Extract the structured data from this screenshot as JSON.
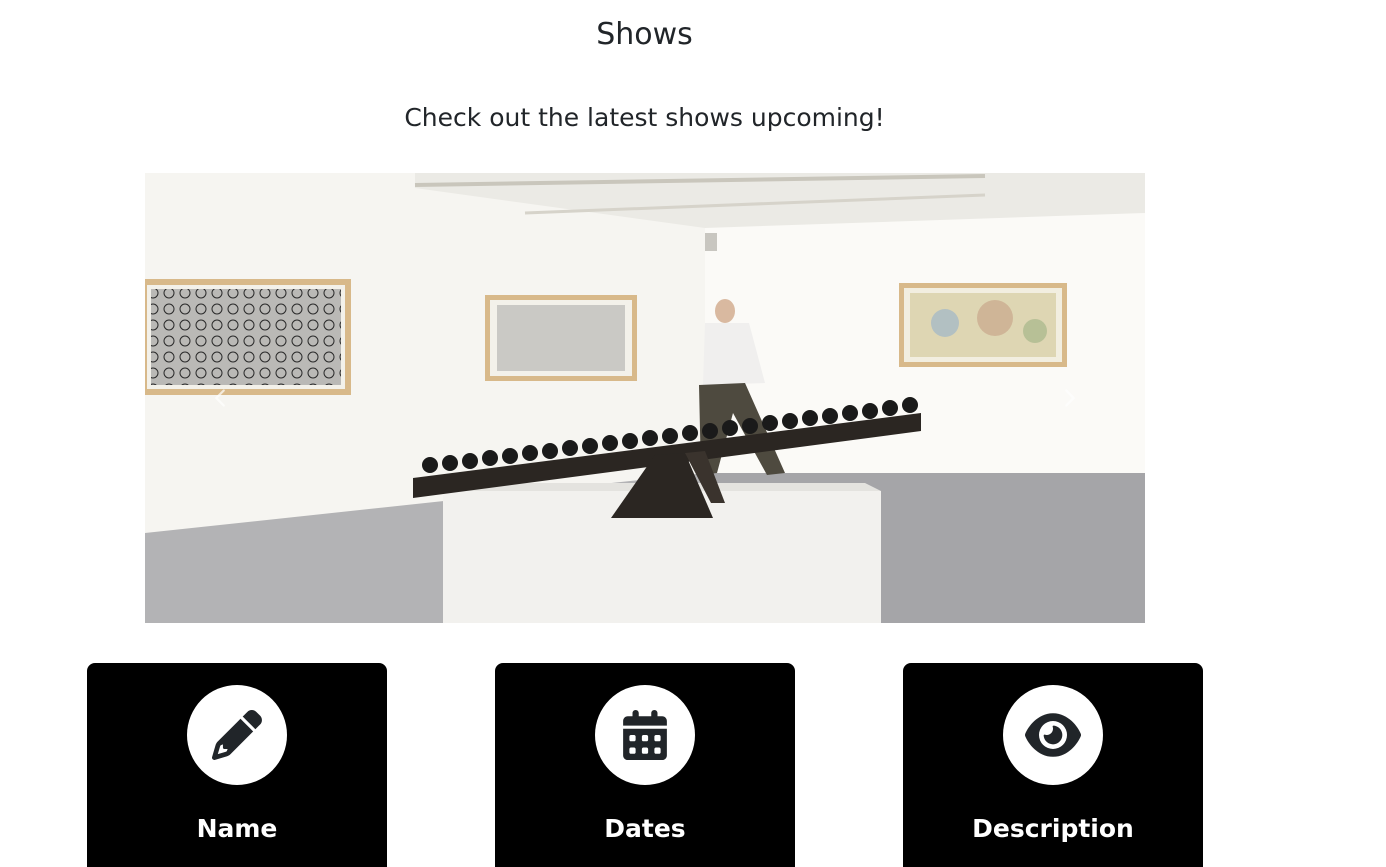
{
  "header": {
    "title": "Shows",
    "subtitle": "Check out the latest shows upcoming!"
  },
  "carousel": {
    "image_description_icon": "gallery-photo",
    "prev_icon": "chevron-left-icon",
    "next_icon": "chevron-right-icon"
  },
  "cards": [
    {
      "label": "Name",
      "icon": "pencil-icon"
    },
    {
      "label": "Dates",
      "icon": "calendar-icon"
    },
    {
      "label": "Description",
      "icon": "eye-icon"
    }
  ],
  "colors": {
    "card_bg": "#000000",
    "icon_circle": "#ffffff",
    "icon_fg": "#212529",
    "text": "#212529"
  }
}
